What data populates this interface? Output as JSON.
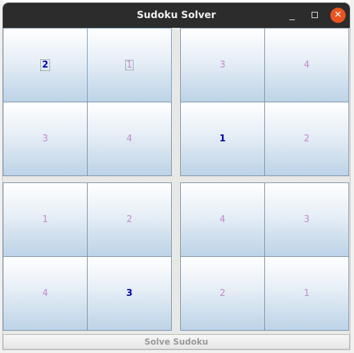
{
  "window": {
    "title": "Sudoku Solver",
    "minimize_icon": "minimize-icon",
    "maximize_icon": "maximize-icon",
    "close_icon": "close-icon",
    "close_glyph": "✕",
    "close_color": "#e95420"
  },
  "grid": {
    "cells": [
      {
        "value": "2",
        "state": "given"
      },
      {
        "value": "1",
        "state": "solved"
      },
      {
        "value": "3",
        "state": "solved"
      },
      {
        "value": "4",
        "state": "solved"
      },
      {
        "value": "3",
        "state": "solved"
      },
      {
        "value": "4",
        "state": "solved"
      },
      {
        "value": "1",
        "state": "given"
      },
      {
        "value": "2",
        "state": "solved"
      },
      {
        "value": "1",
        "state": "solved"
      },
      {
        "value": "2",
        "state": "solved"
      },
      {
        "value": "4",
        "state": "solved"
      },
      {
        "value": "3",
        "state": "solved"
      },
      {
        "value": "4",
        "state": "solved"
      },
      {
        "value": "3",
        "state": "given"
      },
      {
        "value": "2",
        "state": "solved"
      },
      {
        "value": "1",
        "state": "solved"
      }
    ],
    "given_color": "#0000aa",
    "solved_color": "#c28ac8"
  },
  "actions": {
    "solve_label": "Solve Sudoku"
  }
}
